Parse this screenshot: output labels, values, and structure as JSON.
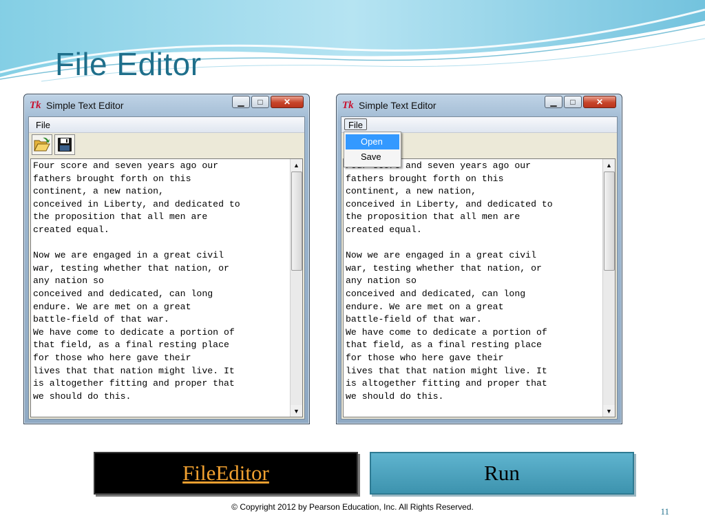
{
  "slide": {
    "title": "File Editor",
    "copyright": "© Copyright 2012 by Pearson Education, Inc. All Rights Reserved.",
    "page_number": "11"
  },
  "colors": {
    "title": "#1f6f8b",
    "run_button_bg": "#3d93ae",
    "fileeditor_link": "#f0a030",
    "menu_highlight": "#3399ff"
  },
  "window_left": {
    "icon": "tk-feather-icon",
    "title": "Simple Text Editor",
    "menu_file_label": "File",
    "toolbar": [
      "open-folder-icon",
      "save-disk-icon"
    ],
    "text": "Four score and seven years ago our\nfathers brought forth on this\ncontinent, a new nation,\nconceived in Liberty, and dedicated to\nthe proposition that all men are\ncreated equal.\n\nNow we are engaged in a great civil\nwar, testing whether that nation, or\nany nation so\nconceived and dedicated, can long\nendure. We are met on a great\nbattle-field of that war.\nWe have come to dedicate a portion of\nthat field, as a final resting place\nfor those who here gave their\nlives that that nation might live. It\nis altogether fitting and proper that\nwe should do this."
  },
  "window_right": {
    "icon": "tk-feather-icon",
    "title": "Simple Text Editor",
    "menu_file_label": "File",
    "menu_open": true,
    "dropdown": {
      "open_label": "Open",
      "save_label": "Save",
      "highlighted": "Open"
    },
    "text": "Four score and seven years ago our\nfathers brought forth on this\ncontinent, a new nation,\nconceived in Liberty, and dedicated to\nthe proposition that all men are\ncreated equal.\n\nNow we are engaged in a great civil\nwar, testing whether that nation, or\nany nation so\nconceived and dedicated, can long\nendure. We are met on a great\nbattle-field of that war.\nWe have come to dedicate a portion of\nthat field, as a final resting place\nfor those who here gave their\nlives that that nation might live. It\nis altogether fitting and proper that\nwe should do this."
  },
  "buttons": {
    "fileeditor_label": "FileEditor",
    "run_label": "Run"
  }
}
